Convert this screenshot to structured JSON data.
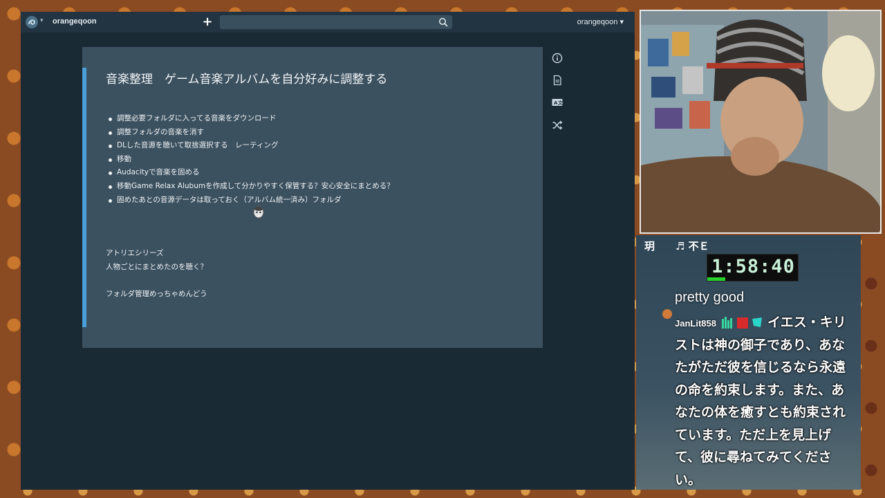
{
  "app": {
    "username": "orangeqoon",
    "account_menu_label": "orangeqoon",
    "search_placeholder": ""
  },
  "note": {
    "title": "音楽整理　ゲーム音楽アルバムを自分好みに調整する",
    "bullets": [
      "調整必要フォルダに入ってる音楽をダウンロード",
      "調整フォルダの音楽を消す",
      "DLした音源を聴いて取捨選択する　レーティング",
      "移動",
      "Audacityで音楽を固める",
      "移動Game Relax Alubumを作成して分かりやすく保管する？安心安全にまとめる？",
      "固めたあとの音源データは取っておく（アルバム統一済み）フォルダ"
    ],
    "para1": "アトリエシリーズ",
    "para2": "人物ごとにまとめたのを聴く？",
    "para3": "フォルダ管理めっちゃめんどう"
  },
  "tools": [
    "info-icon",
    "document-icon",
    "translate-icon",
    "shuffle-icon"
  ],
  "stream": {
    "ticker": "玥　　♬ 不Ｅ",
    "timer": "1:58:40",
    "timer_progress": 0.2,
    "chat_message": "pretty good",
    "chat_author": "JanLit858",
    "chat_body": "イエス・キリストは神の御子であり、あなたがただ彼を信じるなら永遠の命を約束します。また、あなたの体を癒すとも約束されています。ただ上を見上げて、彼に尋ねてみてください。",
    "accent_color": "#27d12b"
  }
}
